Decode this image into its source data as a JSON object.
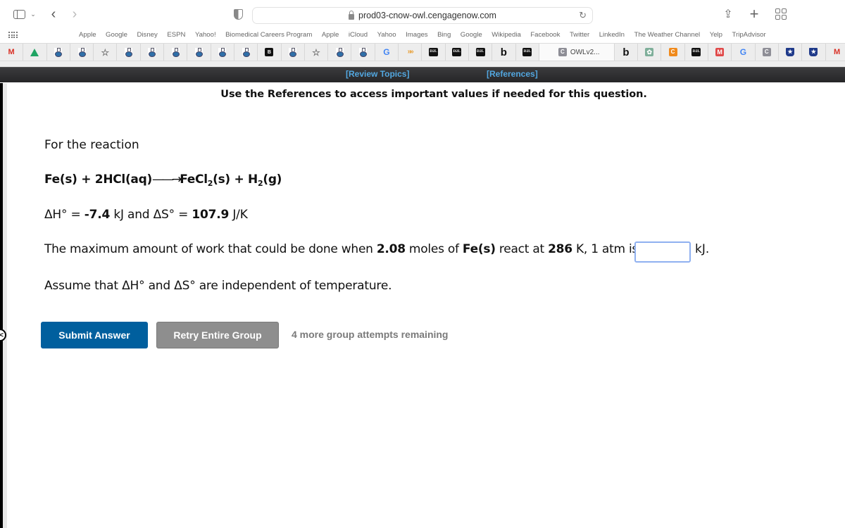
{
  "browser": {
    "url": "prod03-cnow-owl.cengagenow.com",
    "favorites": [
      "Apple",
      "Google",
      "Disney",
      "ESPN",
      "Yahoo!",
      "Biomedical Careers Program",
      "Apple",
      "iCloud",
      "Yahoo",
      "Images",
      "Bing",
      "Google",
      "Wikipedia",
      "Facebook",
      "Twitter",
      "LinkedIn",
      "The Weather Channel",
      "Yelp",
      "TripAdvisor"
    ],
    "tabs": [
      {
        "icon": "gmail-icon",
        "glyph": "M"
      },
      {
        "icon": "google-drive-icon",
        "glyph": ""
      },
      {
        "icon": "owl-flask-icon",
        "glyph": ""
      },
      {
        "icon": "owl-flask-icon",
        "glyph": ""
      },
      {
        "icon": "star-icon",
        "glyph": "☆"
      },
      {
        "icon": "owl-flask-icon",
        "glyph": ""
      },
      {
        "icon": "owl-flask-icon",
        "glyph": ""
      },
      {
        "icon": "owl-flask-icon",
        "glyph": ""
      },
      {
        "icon": "owl-flask-icon",
        "glyph": ""
      },
      {
        "icon": "owl-flask-icon",
        "glyph": ""
      },
      {
        "icon": "owl-flask-icon",
        "glyph": ""
      },
      {
        "icon": "book-icon",
        "glyph": "B"
      },
      {
        "icon": "owl-flask-icon",
        "glyph": ""
      },
      {
        "icon": "star-icon",
        "glyph": "☆"
      },
      {
        "icon": "owl-flask-icon",
        "glyph": ""
      },
      {
        "icon": "owl-flask-icon",
        "glyph": ""
      },
      {
        "icon": "google-icon",
        "glyph": "G"
      },
      {
        "icon": "arrows-icon",
        "glyph": "»»"
      },
      {
        "icon": "d2l-icon",
        "glyph": "D2L"
      },
      {
        "icon": "d2l-icon",
        "glyph": "D2L"
      },
      {
        "icon": "d2l-icon",
        "glyph": "D2L"
      },
      {
        "icon": "bartleby-icon",
        "glyph": "b"
      },
      {
        "icon": "d2l-icon",
        "glyph": "D2L"
      },
      {
        "icon": "cengage-icon",
        "glyph": "C",
        "title": "OWLv2...",
        "active": true
      },
      {
        "icon": "bartleby-icon",
        "glyph": "b"
      },
      {
        "icon": "chatgpt-icon",
        "glyph": "✿"
      },
      {
        "icon": "chegg-icon",
        "glyph": "C"
      },
      {
        "icon": "d2l-icon",
        "glyph": "D2L"
      },
      {
        "icon": "mcgraw-icon",
        "glyph": "M"
      },
      {
        "icon": "google-icon",
        "glyph": "G"
      },
      {
        "icon": "cengage-icon",
        "glyph": "C"
      },
      {
        "icon": "shield-star-icon",
        "glyph": "★"
      },
      {
        "icon": "shield-star-icon",
        "glyph": "★"
      },
      {
        "icon": "gmail-icon",
        "glyph": "M"
      }
    ]
  },
  "toolbar": {
    "review_topics": "[Review Topics]",
    "references": "[References]"
  },
  "question": {
    "instructions": "Use the References to access important values if needed for this question.",
    "intro": "For the reaction",
    "equation": {
      "reactants": "Fe(s) + 2HCl(aq)",
      "arrow": "——→",
      "product1_pre": "FeCl",
      "product1_sub": "2",
      "product1_post": "(s) + H",
      "product2_sub": "2",
      "product2_post": "(g)"
    },
    "thermo": {
      "dH_label": "ΔH° = ",
      "dH_value": "-7.4",
      "dH_unit": " kJ and ΔS° = ",
      "dS_value": "107.9",
      "dS_unit": " J/K"
    },
    "work": {
      "part1": "The maximum amount of work that could be done when ",
      "moles": "2.08",
      "part2": " moles of ",
      "species": "Fe(s)",
      "part3": " react at ",
      "temperature": "286",
      "part4": " K, 1 atm is "
    },
    "answer_value": "",
    "answer_unit": "kJ.",
    "assume": "Assume that ΔH° and ΔS° are independent of temperature."
  },
  "actions": {
    "submit": "Submit Answer",
    "retry": "Retry Entire Group",
    "attempts_remaining": "4 more group attempts remaining"
  },
  "colors": {
    "submit_bg": "#005f9e",
    "retry_bg": "#8e8e8e",
    "link": "#52a7e0",
    "input_border": "#8fb0f0"
  }
}
